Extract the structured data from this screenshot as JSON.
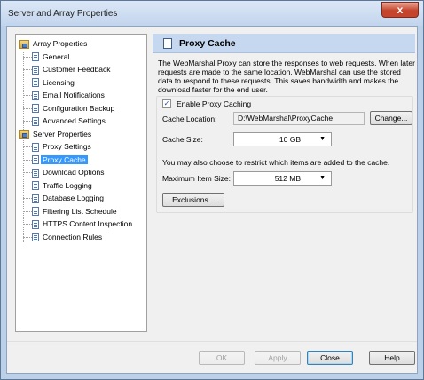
{
  "window": {
    "title": "Server and Array Properties",
    "close_glyph": "x"
  },
  "tree": {
    "items": [
      {
        "label": "Array Properties",
        "level": 0,
        "icon": "folder-icon",
        "selected": false
      },
      {
        "label": "General",
        "level": 1,
        "icon": "page-icon",
        "selected": false
      },
      {
        "label": "Customer Feedback",
        "level": 1,
        "icon": "page-icon",
        "selected": false
      },
      {
        "label": "Licensing",
        "level": 1,
        "icon": "page-icon",
        "selected": false
      },
      {
        "label": "Email Notifications",
        "level": 1,
        "icon": "page-icon",
        "selected": false
      },
      {
        "label": "Configuration Backup",
        "level": 1,
        "icon": "page-icon",
        "selected": false
      },
      {
        "label": "Advanced Settings",
        "level": 1,
        "icon": "page-icon",
        "selected": false
      },
      {
        "label": "Server Properties",
        "level": 0,
        "icon": "folder-icon",
        "selected": false
      },
      {
        "label": "Proxy Settings",
        "level": 1,
        "icon": "page-icon",
        "selected": false
      },
      {
        "label": "Proxy Cache",
        "level": 1,
        "icon": "page-icon",
        "selected": true
      },
      {
        "label": "Download Options",
        "level": 1,
        "icon": "page-icon",
        "selected": false
      },
      {
        "label": "Traffic Logging",
        "level": 1,
        "icon": "page-icon",
        "selected": false
      },
      {
        "label": "Database Logging",
        "level": 1,
        "icon": "page-icon",
        "selected": false
      },
      {
        "label": "Filtering List Schedule",
        "level": 1,
        "icon": "page-icon",
        "selected": false
      },
      {
        "label": "HTTPS Content Inspection",
        "level": 1,
        "icon": "page-icon",
        "selected": false
      },
      {
        "label": "Connection Rules",
        "level": 1,
        "icon": "page-icon",
        "selected": false
      }
    ]
  },
  "panel": {
    "header": "Proxy Cache",
    "description": "The WebMarshal Proxy can store the responses to web requests. When later requests are made to the same location, WebMarshal can use the stored data to respond to these requests. This saves bandwidth and makes the download faster for the end user.",
    "enable_label": "Enable Proxy Caching",
    "enable_checked": true,
    "cache_location_label": "Cache Location:",
    "cache_location_value": "D:\\WebMarshal\\ProxyCache",
    "change_button": "Change...",
    "cache_size_label": "Cache Size:",
    "cache_size_value": "10  GB",
    "restrict_note": "You may also choose to restrict which items are added to the cache.",
    "max_item_label": "Maximum Item Size:",
    "max_item_value": "512  MB",
    "exclusions_button": "Exclusions..."
  },
  "footer": {
    "ok": "OK",
    "apply": "Apply",
    "close": "Close",
    "help": "Help"
  },
  "colors": {
    "selection": "#3399ff",
    "header_band": "#c5d8ef",
    "frame": "#bcd0e8"
  }
}
